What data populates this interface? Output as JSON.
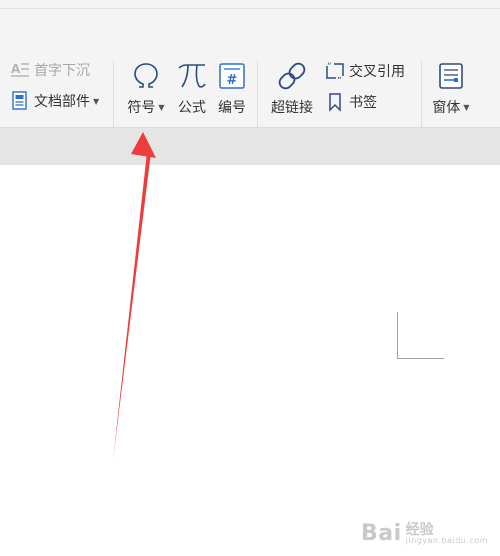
{
  "ribbon": {
    "left_group": {
      "drop_cap_label": "首字下沉",
      "doc_parts_label": "文档部件"
    },
    "symbols_group": {
      "symbol_label": "符号",
      "formula_label": "公式",
      "numbering_label": "编号"
    },
    "links_group": {
      "hyperlink_label": "超链接",
      "cross_ref_label": "交叉引用",
      "bookmark_label": "书签"
    },
    "window_group": {
      "window_label": "窗体"
    }
  },
  "icons": {
    "drop_cap": "drop-cap-icon",
    "doc_parts": "document-parts-icon",
    "symbol": "omega-icon",
    "formula": "pi-icon",
    "numbering": "numbering-icon",
    "hyperlink": "chain-link-icon",
    "cross_ref": "cross-reference-icon",
    "bookmark": "bookmark-icon",
    "window": "form-window-icon"
  },
  "annotation": {
    "arrow_color": "#ee3b3b"
  },
  "watermark": {
    "brand": "Bai",
    "product": "经验",
    "url": "jingyan.baidu.com"
  },
  "colors": {
    "ribbon_bg": "#f4f4f4",
    "band_bg": "#e5e5e5",
    "icon_blue": "#2f6fc9",
    "disabled_text": "#a8a8a8"
  }
}
